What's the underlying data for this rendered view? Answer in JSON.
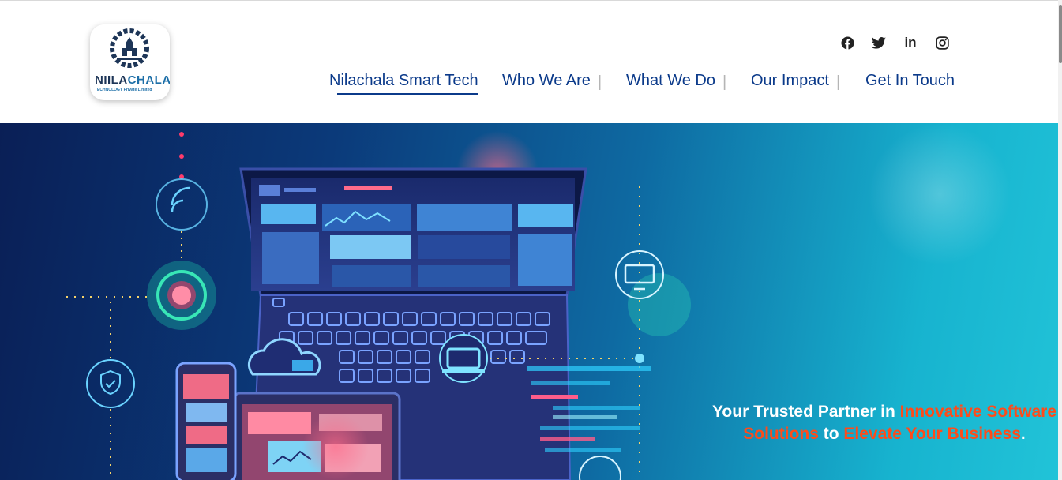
{
  "brand": {
    "logo_word_main": "NIILA",
    "logo_word_accent": "CHALA",
    "logo_subtitle": "TECHNOLOGY Private Limited"
  },
  "social": [
    {
      "name": "facebook-icon"
    },
    {
      "name": "twitter-icon"
    },
    {
      "name": "linkedin-icon",
      "glyph": "in"
    },
    {
      "name": "instagram-icon"
    }
  ],
  "nav": {
    "items": [
      {
        "label": "Nilachala Smart Tech",
        "active": true
      },
      {
        "label": "Who We Are"
      },
      {
        "label": "What We Do"
      },
      {
        "label": "Our Impact"
      },
      {
        "label": "Get In Touch"
      }
    ],
    "separator": "|"
  },
  "hero": {
    "tagline": {
      "part1": "Your Trusted Partner in ",
      "highlight1": "Innovative Software Solutions",
      "part2": " to ",
      "highlight2": "Elevate Your Business",
      "part3": "."
    }
  },
  "colors": {
    "nav_text": "#0b3a8a",
    "highlight": "#ff4b1a",
    "hero_dark": "#0a1f56",
    "hero_light": "#21c3d8"
  }
}
